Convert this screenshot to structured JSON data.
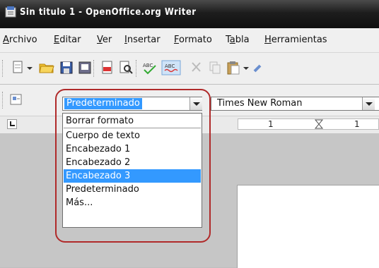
{
  "window": {
    "title": "Sin titulo 1 - OpenOffice.org Writer"
  },
  "menubar": [
    {
      "label": "Archivo",
      "u": "A",
      "rest": "rchivo"
    },
    {
      "label": "Editar",
      "u": "E",
      "rest": "ditar"
    },
    {
      "label": "Ver",
      "u": "V",
      "rest": "er"
    },
    {
      "label": "Insertar",
      "u": "I",
      "rest": "nsertar"
    },
    {
      "label": "Formato",
      "u": "F",
      "rest": "ormato"
    },
    {
      "label": "Tabla",
      "pre": "T",
      "u": "a",
      "rest": "bla"
    },
    {
      "label": "Herramientas",
      "u": "H",
      "rest": "erramientas"
    }
  ],
  "format_bar": {
    "style_value": "Predeterminado",
    "font_value": "Times New Roman"
  },
  "ruler": {
    "marks": [
      "1",
      "1"
    ]
  },
  "style_dropdown": {
    "items": [
      "Borrar formato",
      "Cuerpo de texto",
      "Encabezado 1",
      "Encabezado 2",
      "Encabezado 3",
      "Predeterminado",
      "Más..."
    ],
    "selected": "Encabezado 3"
  },
  "colors": {
    "accent": "#3399ff",
    "highlight_ring": "#b02a2a"
  }
}
